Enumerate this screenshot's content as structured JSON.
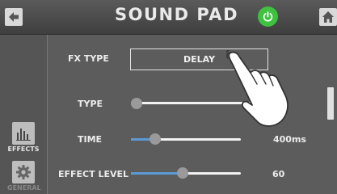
{
  "header": {
    "title": "SOUND PAD"
  },
  "sidebar": {
    "items": [
      {
        "label": "EFFECTS",
        "icon": "equalizer-icon"
      },
      {
        "label": "GENERAL",
        "icon": "gear-icon"
      }
    ]
  },
  "settings": {
    "fx_type": {
      "label": "FX TYPE",
      "value": "DELAY"
    },
    "type": {
      "label": "TYPE",
      "level": 0.0
    },
    "time": {
      "label": "TIME",
      "value": "400ms",
      "level": 0.22
    },
    "effect_level": {
      "label": "EFFECT LEVEL",
      "value": "60",
      "level": 0.47
    }
  },
  "colors": {
    "accent": "#5b9bd5",
    "power": "#3fc23f",
    "background": "#5c5c5c"
  }
}
